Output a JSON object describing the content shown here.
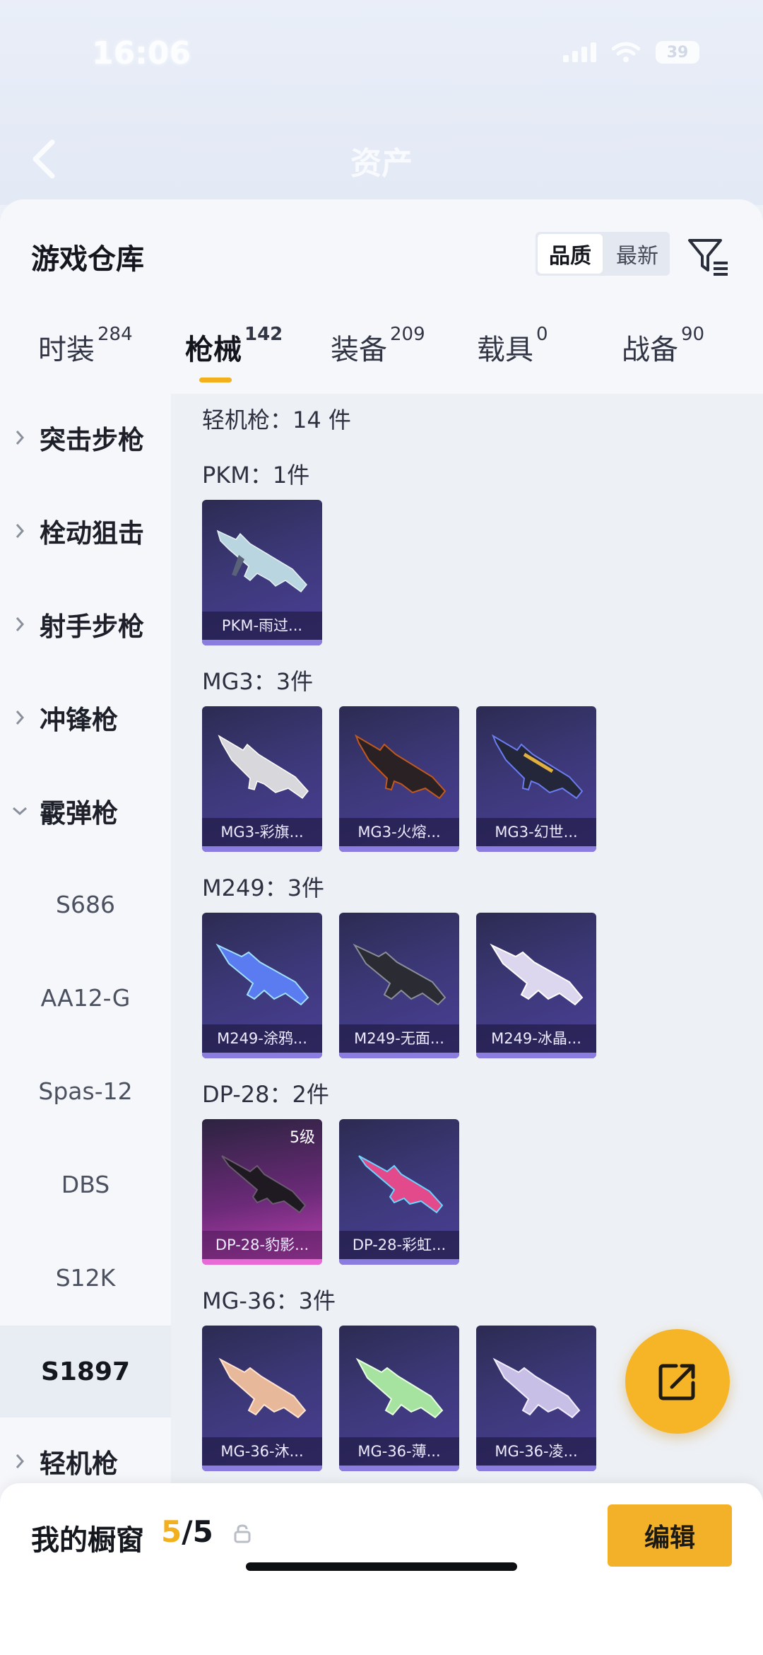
{
  "status_bar": {
    "time": "16:06",
    "battery": "39"
  },
  "header": {
    "title": "资产"
  },
  "sheet": {
    "title": "游戏仓库",
    "sort": {
      "options": [
        "品质",
        "最新"
      ],
      "selected": "品质"
    }
  },
  "tabs": [
    {
      "label": "时装",
      "count": "284"
    },
    {
      "label": "枪械",
      "count": "142",
      "active": true
    },
    {
      "label": "装备",
      "count": "209"
    },
    {
      "label": "载具",
      "count": "0"
    },
    {
      "label": "战备",
      "count": "90"
    }
  ],
  "sidebar": {
    "categories": [
      "突击步枪",
      "栓动狙击",
      "射手步枪",
      "冲锋枪",
      "霰弹枪"
    ],
    "expanded_items": [
      "S686",
      "AA12-G",
      "Spas-12",
      "DBS",
      "S12K",
      "S1897"
    ],
    "selected": "S1897",
    "last_category": "轻机枪"
  },
  "content": {
    "group_title": "轻机枪：14 件",
    "sections": [
      {
        "title": "PKM：1件",
        "items": [
          {
            "name": "PKM-雨过..."
          }
        ]
      },
      {
        "title": "MG3：3件",
        "items": [
          {
            "name": "MG3-彩旗..."
          },
          {
            "name": "MG3-火熔..."
          },
          {
            "name": "MG3-幻世..."
          }
        ]
      },
      {
        "title": "M249：3件",
        "items": [
          {
            "name": "M249-涂鸦..."
          },
          {
            "name": "M249-无面..."
          },
          {
            "name": "M249-冰晶..."
          }
        ]
      },
      {
        "title": "DP-28：2件",
        "items": [
          {
            "name": "DP-28-豹影...",
            "level": "5级",
            "highlight": true
          },
          {
            "name": "DP-28-彩虹..."
          }
        ]
      },
      {
        "title": "MG-36：3件",
        "items": [
          {
            "name": "MG-36-沐..."
          },
          {
            "name": "MG-36-薄..."
          },
          {
            "name": "MG-36-凌..."
          }
        ]
      }
    ]
  },
  "showcase": {
    "label": "我的橱窗",
    "current": "5",
    "total": "/5",
    "edit_label": "编辑"
  },
  "colors": {
    "accent": "#f2b01e",
    "card_bg": "#3c3878",
    "card_highlight": "#c143b5",
    "page_bg": "#f5f7fb"
  }
}
